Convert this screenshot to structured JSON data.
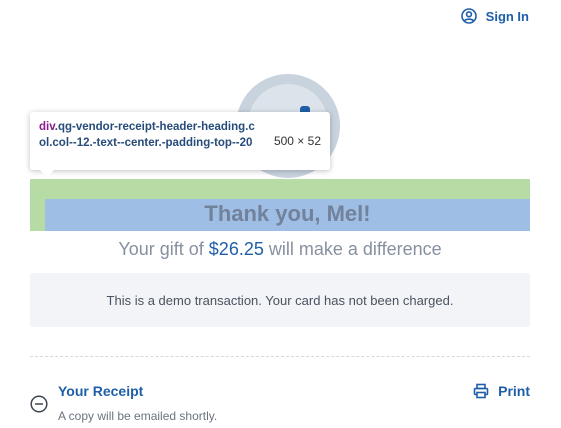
{
  "header": {
    "signin_label": "Sign In",
    "signin_icon": "user-circle-icon"
  },
  "receipt_header": {
    "thanks": "Thank you, Mel!",
    "gift_prefix": "Your gift of ",
    "gift_amount": "$26.25",
    "gift_suffix": " will make a difference"
  },
  "notice": {
    "text": "This is a demo transaction. Your card has not been charged."
  },
  "receipt": {
    "title": "Your Receipt",
    "subtitle": "A copy will be emailed shortly.",
    "toggle_icon": "minus-circle-icon",
    "print_label": "Print",
    "print_icon": "printer-icon"
  },
  "devtools_tooltip": {
    "tag": "div",
    "classes": ".qg-vendor-receipt-header-heading.col.col--12.-text--center.-padding-top--20",
    "dimensions": "500 × 52"
  },
  "colors": {
    "accent": "#1f5fa8",
    "highlight_padding": "#b7dba4",
    "highlight_content": "#9fbee6"
  }
}
